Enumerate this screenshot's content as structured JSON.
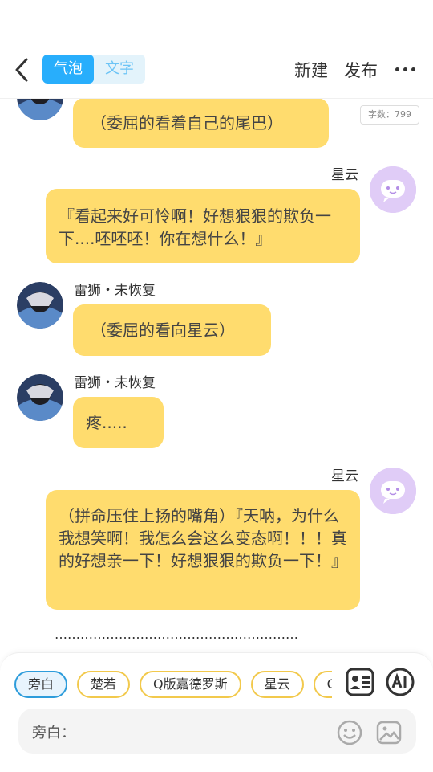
{
  "header": {
    "mode_tabs": [
      {
        "label": "气泡",
        "active": true
      },
      {
        "label": "文字",
        "active": false
      }
    ],
    "new_label": "新建",
    "publish_label": "发布",
    "word_count": "字数：799"
  },
  "messages": [
    {
      "side": "left",
      "speaker": "",
      "text": "（委屈的看着自己的尾巴）"
    },
    {
      "side": "right",
      "speaker": "星云",
      "text": "『看起来好可怜啊！好想狠狠的欺负一下....呸呸呸！你在想什么！』"
    },
    {
      "side": "left",
      "speaker": "雷狮・未恢复",
      "text": "（委屈的看向星云）"
    },
    {
      "side": "left",
      "speaker": "雷狮・未恢复",
      "text": "疼....."
    },
    {
      "side": "right",
      "speaker": "星云",
      "text": "（拼命压住上扬的嘴角）『天呐，为什么我想笑啊！我怎么会这么变态啊！！！真的好想亲一下！好想狠狠的欺负一下！』"
    }
  ],
  "divider_dots": "…………………………………………………",
  "bottom": {
    "chips": [
      "旁白",
      "楚若",
      "Q版嘉德罗斯",
      "星云",
      "Q版"
    ],
    "input_label": "旁白："
  },
  "colors": {
    "accent": "#28aefc",
    "bubble": "#ffdc6e",
    "chip_border": "#f2c94c",
    "chip_selected": "#2d9cdb",
    "avatar_right": "#e0ccf7"
  }
}
